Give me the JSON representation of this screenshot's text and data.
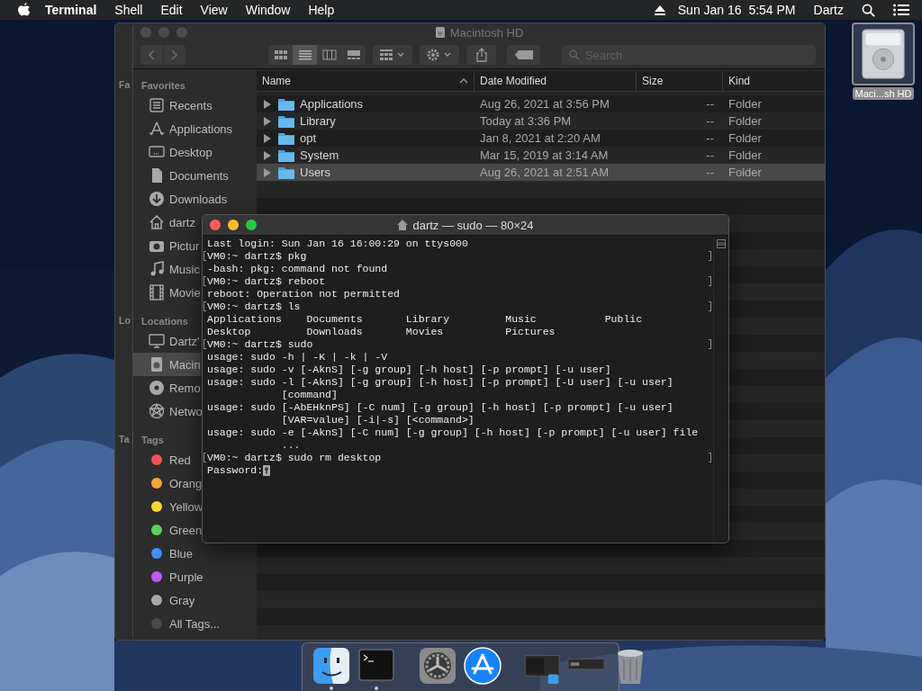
{
  "menu_bar": {
    "app_name": "Terminal",
    "menus": [
      "Shell",
      "Edit",
      "View",
      "Window",
      "Help"
    ],
    "clock": "Sun Jan 16  5:54 PM",
    "user": "Dartz"
  },
  "desktop_icons": [
    {
      "label": "Maci...sh HD",
      "selected": true
    }
  ],
  "back_window": {
    "sidebar_headings": [
      "Fa",
      "Lo",
      "Ta"
    ]
  },
  "finder": {
    "title": "Macintosh HD",
    "active": false,
    "views": [
      {
        "selected": false
      },
      {
        "selected": true
      },
      {
        "selected": false
      },
      {
        "selected": false
      }
    ],
    "search": {
      "placeholder": "Search"
    },
    "sidebar": [
      {
        "heading": "Favorites",
        "kind": "places",
        "items": [
          {
            "label": "Recents",
            "selected": false
          },
          {
            "label": "Applications",
            "selected": false
          },
          {
            "label": "Desktop",
            "selected": false
          },
          {
            "label": "Documents",
            "selected": false
          },
          {
            "label": "Downloads",
            "selected": false
          },
          {
            "label": "dartz",
            "selected": false
          },
          {
            "label": "Pictur",
            "selected": false
          },
          {
            "label": "Music",
            "selected": false
          },
          {
            "label": "Movie",
            "selected": false
          }
        ]
      },
      {
        "heading": "Locations",
        "kind": "places",
        "items": [
          {
            "label": "Dartz'",
            "selected": false
          },
          {
            "label": "Macin",
            "selected": true
          },
          {
            "label": "Remo",
            "selected": false
          },
          {
            "label": "Netwo",
            "selected": false
          }
        ]
      },
      {
        "heading": "Tags",
        "kind": "tags",
        "items": [
          {
            "label": "Red",
            "color": "#f0525a"
          },
          {
            "label": "Orang",
            "color": "#f5a33c"
          },
          {
            "label": "Yellow",
            "color": "#f6d731"
          },
          {
            "label": "Green",
            "color": "#5bd25b"
          },
          {
            "label": "Blue",
            "color": "#3f8ff6"
          },
          {
            "label": "Purple",
            "color": "#bf5af2"
          },
          {
            "label": "Gray",
            "color": "#a8a8a8"
          },
          {
            "label": "All Tags...",
            "color": "#4a4a4a"
          }
        ]
      }
    ],
    "columns": [
      {
        "label": "Name",
        "sorted": true
      },
      {
        "label": "Date Modified",
        "sorted": false
      },
      {
        "label": "Size",
        "sorted": false
      },
      {
        "label": "Kind",
        "sorted": false
      }
    ],
    "rows": [
      {
        "name": "Applications",
        "date_modified": "Aug 26, 2021 at 3:56 PM",
        "size": "--",
        "kind_text": "Folder",
        "selected": false
      },
      {
        "name": "Library",
        "date_modified": "Today at 3:36 PM",
        "size": "--",
        "kind_text": "Folder",
        "selected": false
      },
      {
        "name": "opt",
        "date_modified": "Jan 8, 2021 at 2:20 AM",
        "size": "--",
        "kind_text": "Folder",
        "selected": false
      },
      {
        "name": "System",
        "date_modified": "Mar 15, 2019 at 3:14 AM",
        "size": "--",
        "kind_text": "Folder",
        "selected": false
      },
      {
        "name": "Users",
        "date_modified": "Aug 26, 2021 at 2:51 AM",
        "size": "--",
        "kind_text": "Folder",
        "selected": true
      }
    ]
  },
  "terminal": {
    "title": "dartz — sudo — 80×24",
    "active": true,
    "lines": [
      {
        "kind": "output",
        "text": "Last login: Sun Jan 16 16:00:29 on ttys000"
      },
      {
        "kind": "prompt",
        "text": "VM0:~ dartz$ pkg"
      },
      {
        "kind": "output",
        "text": "-bash: pkg: command not found"
      },
      {
        "kind": "prompt",
        "text": "VM0:~ dartz$ reboot"
      },
      {
        "kind": "output",
        "text": "reboot: Operation not permitted"
      },
      {
        "kind": "prompt",
        "text": "VM0:~ dartz$ ls"
      },
      {
        "kind": "output",
        "text": "Applications    Documents       Library         Music           Public"
      },
      {
        "kind": "output",
        "text": "Desktop         Downloads       Movies          Pictures"
      },
      {
        "kind": "prompt",
        "text": "VM0:~ dartz$ sudo"
      },
      {
        "kind": "output",
        "text": "usage: sudo -h | -K | -k | -V"
      },
      {
        "kind": "output",
        "text": "usage: sudo -v [-AknS] [-g group] [-h host] [-p prompt] [-u user]"
      },
      {
        "kind": "output",
        "text": "usage: sudo -l [-AknS] [-g group] [-h host] [-p prompt] [-U user] [-u user]"
      },
      {
        "kind": "output",
        "text": "            [command]"
      },
      {
        "kind": "output",
        "text": "usage: sudo [-AbEHknPS] [-C num] [-g group] [-h host] [-p prompt] [-u user]"
      },
      {
        "kind": "output",
        "text": "            [VAR=value] [-i|-s] [<command>]"
      },
      {
        "kind": "output",
        "text": "usage: sudo -e [-AknS] [-C num] [-g group] [-h host] [-p prompt] [-u user] file"
      },
      {
        "kind": "output",
        "text": "            ..."
      },
      {
        "kind": "prompt",
        "text": "VM0:~ dartz$ sudo rm desktop"
      },
      {
        "kind": "input",
        "text": "Password:"
      }
    ]
  },
  "dock": [
    {
      "running": true
    },
    {
      "running": true
    },
    {
      "running": false
    },
    {
      "running": false
    },
    {
      "running": false
    },
    {
      "running": false
    },
    {
      "running": false
    }
  ]
}
